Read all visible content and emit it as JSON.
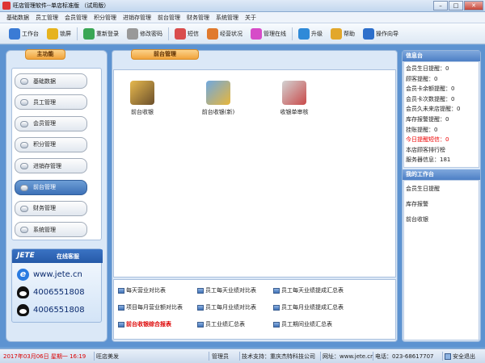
{
  "window": {
    "title": "旺店管理软件--单店标准版 （试用版）"
  },
  "menu": [
    "基础数据",
    "员工管理",
    "会员管理",
    "积分管理",
    "进销存管理",
    "前台管理",
    "财务管理",
    "系统管理",
    "关于"
  ],
  "toolbar": [
    {
      "label": "工作台",
      "icon": "workbench-icon",
      "color": "#3a7bd5"
    },
    {
      "label": "锁屏",
      "icon": "lock-icon",
      "color": "#e6b31e"
    },
    {
      "label": "重新登录",
      "icon": "relogin-icon",
      "color": "#3aa655"
    },
    {
      "label": "修改密码",
      "icon": "key-icon",
      "color": "#999999"
    },
    {
      "label": "短信",
      "icon": "sms-icon",
      "color": "#d94d4d"
    },
    {
      "label": "经营状况",
      "icon": "pie-chart-icon",
      "color": "#e07a2e"
    },
    {
      "label": "管理在线",
      "icon": "online-icon",
      "color": "#d64cc8"
    },
    {
      "label": "升级",
      "icon": "upgrade-icon",
      "color": "#2f8ad8"
    },
    {
      "label": "帮助",
      "icon": "help-icon",
      "color": "#e2a72b"
    },
    {
      "label": "操作向导",
      "icon": "guide-icon",
      "color": "#2d6fcb"
    }
  ],
  "left": {
    "tab": "主功能",
    "items": [
      "基础数据",
      "员工管理",
      "会员管理",
      "积分管理",
      "进销存管理",
      "前台管理",
      "财务管理",
      "系统管理"
    ],
    "active": "前台管理",
    "ad": {
      "logo": "JETE",
      "online": "在线客服",
      "site": "www.jete.cn",
      "phone1": "4006551808",
      "phone2": "4006551808"
    }
  },
  "center": {
    "tab": "前台管理",
    "apps": [
      "前台收银",
      "前台收银(新)",
      "收银单审核"
    ],
    "reports": [
      {
        "label": "每天营业对比表",
        "red": false
      },
      {
        "label": "员工每天业绩对比表",
        "red": false
      },
      {
        "label": "员工每天业绩提成汇总表",
        "red": false
      },
      {
        "label": "项目每月营业额对比表",
        "red": false
      },
      {
        "label": "员工每月业绩对比表",
        "red": false
      },
      {
        "label": "员工每月业绩提成汇总表",
        "red": false
      },
      {
        "label": "前台收银综合报表",
        "red": true
      },
      {
        "label": "员工业绩汇总表",
        "red": false
      },
      {
        "label": "员工期间业绩汇总表",
        "red": false
      }
    ]
  },
  "right": {
    "info_title": "信息台",
    "info": [
      {
        "text": "会员生日提醒：0",
        "red": false
      },
      {
        "text": "顾客提醒：0",
        "red": false
      },
      {
        "text": "会员卡余额提醒：0",
        "red": false
      },
      {
        "text": "会员卡次数提醒：0",
        "red": false
      },
      {
        "text": "会员久未来店提醒：0",
        "red": false
      },
      {
        "text": "库存报警提醒：0",
        "red": false
      },
      {
        "text": "挂账提醒：0",
        "red": false
      },
      {
        "text": "今日提醒短信：0",
        "red": true
      },
      {
        "text": "本店顾客排行榜",
        "red": false
      },
      {
        "text": "服务器信息：181",
        "red": false
      }
    ],
    "work_title": "我的工作台",
    "work": [
      "会员生日提醒",
      "库存报警",
      "前台收银"
    ]
  },
  "status": {
    "datetime": "2017年03月06日 星期一 16:19",
    "store": "旺店美发",
    "user": "管理员",
    "support": "技术支持：重庆杰特科技公司",
    "site_label": "网址：www.jete.cn",
    "phone": "电话：023-68617707",
    "exit": "安全退出"
  }
}
